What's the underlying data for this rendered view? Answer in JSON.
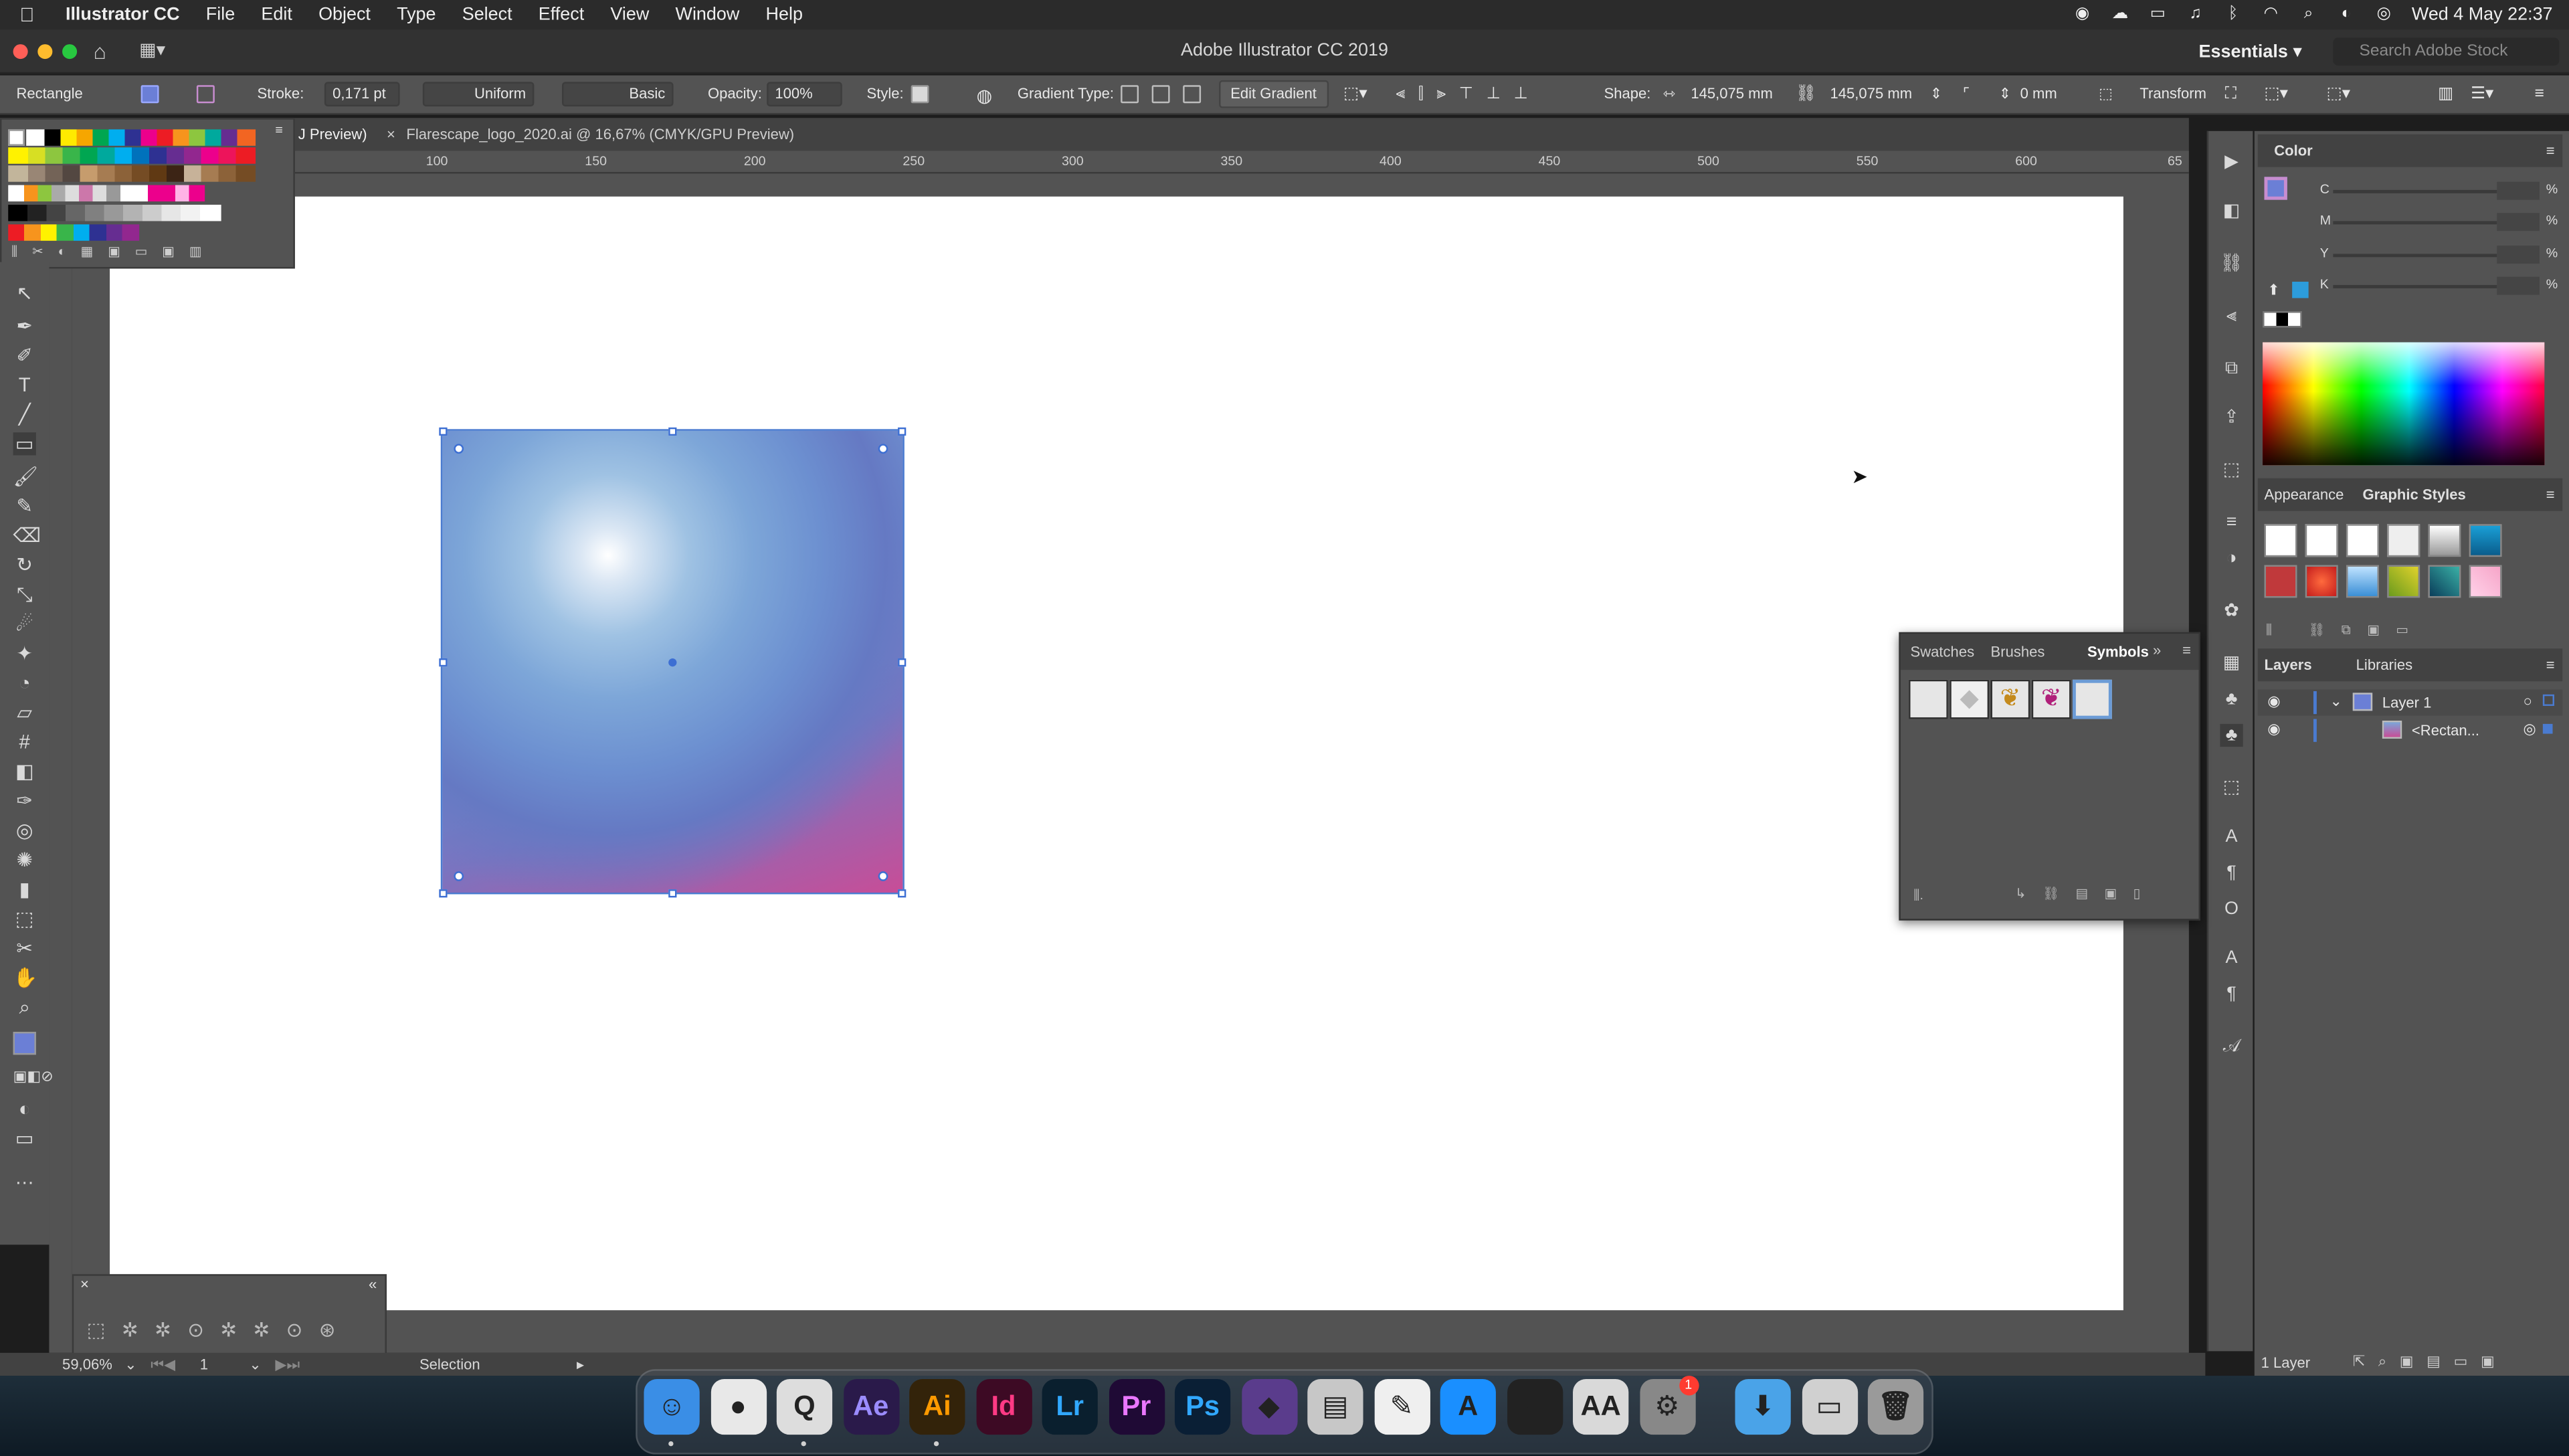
{
  "menubar": {
    "app": "Illustrator CC",
    "items": [
      "File",
      "Edit",
      "Object",
      "Type",
      "Select",
      "Effect",
      "View",
      "Window",
      "Help"
    ],
    "clock": "Wed 4 May  22:37"
  },
  "titlebar": {
    "title": "Adobe Illustrator CC 2019",
    "workspace": "Essentials",
    "search_placeholder": "Search Adobe Stock"
  },
  "controlbar": {
    "selection_kind": "Rectangle",
    "stroke_label": "Stroke:",
    "stroke_value": "0,171 pt",
    "profile_uniform": "Uniform",
    "brush_basic": "Basic",
    "opacity_label": "Opacity:",
    "opacity_value": "100%",
    "style_label": "Style:",
    "gradient_type_label": "Gradient Type:",
    "edit_gradient": "Edit Gradient",
    "shape_label": "Shape:",
    "width_value": "145,075 mm",
    "height_value": "145,075 mm",
    "corner_value": "0 mm",
    "transform": "Transform"
  },
  "tabs": [
    {
      "label": "J Preview)"
    },
    {
      "label": "Flarescape_logo_2020.ai @ 16,67% (CMYK/GPU Preview)"
    }
  ],
  "ruler": {
    "ticks": [
      "100",
      "150",
      "200",
      "250",
      "300",
      "350",
      "400",
      "450",
      "500",
      "550",
      "600",
      "65"
    ]
  },
  "panels": {
    "color_title": "Color",
    "cmyk": [
      {
        "label": "C",
        "unit": "%"
      },
      {
        "label": "M",
        "unit": "%"
      },
      {
        "label": "Y",
        "unit": "%"
      },
      {
        "label": "K",
        "unit": "%"
      }
    ],
    "appearance_tab": "Appearance",
    "graphic_styles_tab": "Graphic Styles",
    "layers_tab": "Layers",
    "libraries_tab": "Libraries",
    "layers": [
      {
        "name": "Layer 1"
      },
      {
        "name": "<Rectan..."
      }
    ],
    "layers_count": "1 Layer"
  },
  "symbols_panel": {
    "tabs": [
      "Swatches",
      "Brushes",
      "Symbols"
    ],
    "active": "Symbols"
  },
  "statusbar": {
    "zoom": "59,06%",
    "artboard": "1",
    "tool": "Selection"
  },
  "dock": {
    "apps": [
      {
        "name": "Finder",
        "glyph": "☺",
        "color": "#3a8ee6"
      },
      {
        "name": "Chrome",
        "glyph": "●",
        "color": "#e8e8e8"
      },
      {
        "name": "QuickTime",
        "glyph": "Q",
        "color": "#dddddd"
      },
      {
        "name": "After Effects",
        "glyph": "Ae",
        "color": "#2a1a4a"
      },
      {
        "name": "Illustrator",
        "glyph": "Ai",
        "color": "#33230a"
      },
      {
        "name": "InDesign",
        "glyph": "Id",
        "color": "#3d0a24"
      },
      {
        "name": "Lightroom",
        "glyph": "Lr",
        "color": "#0a1f2e"
      },
      {
        "name": "Premiere Pro",
        "glyph": "Pr",
        "color": "#1f0a35"
      },
      {
        "name": "Photoshop",
        "glyph": "Ps",
        "color": "#0a1f35"
      },
      {
        "name": "Motion",
        "glyph": "◆",
        "color": "#5a3c8c"
      },
      {
        "name": "Preview",
        "glyph": "▤",
        "color": "#c7c7c7"
      },
      {
        "name": "TextEdit",
        "glyph": "✎",
        "color": "#efefef"
      },
      {
        "name": "App Store",
        "glyph": "A",
        "color": "#1a8fff"
      },
      {
        "name": "Activity Monitor",
        "glyph": "~",
        "color": "#222222"
      },
      {
        "name": "Font Book",
        "glyph": "AA",
        "color": "#d9d9d9"
      },
      {
        "name": "System Preferences",
        "glyph": "⚙",
        "color": "#888888",
        "badge": "1"
      },
      {
        "name": "Downloads",
        "glyph": "⬇",
        "color": "#4aa3e8"
      },
      {
        "name": "Printer",
        "glyph": "▭",
        "color": "#d0d0d0"
      },
      {
        "name": "Trash",
        "glyph": "🗑",
        "color": "#9a9a9a"
      }
    ]
  },
  "colors": {
    "accent": "#3d6fd3",
    "gradient_top": "#7ba6d9",
    "gradient_bottom": "#c84d97"
  }
}
